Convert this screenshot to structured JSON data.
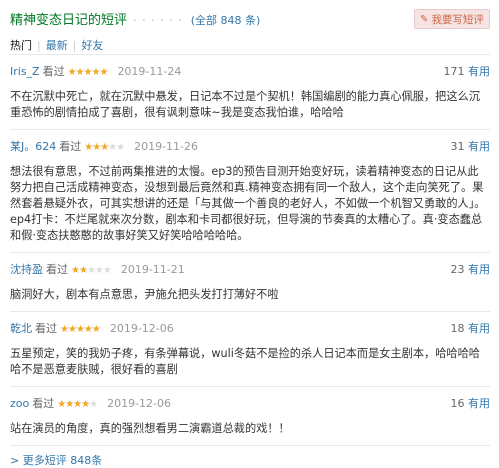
{
  "header": {
    "title": "精神变态日记的短评",
    "dots": "· · · · · ·",
    "all_count": "(全部 848 条)",
    "write_button": "我要写短评",
    "pen_icon": "✎"
  },
  "filters": [
    {
      "label": "热门",
      "active": true
    },
    {
      "label": "最新",
      "active": false
    },
    {
      "label": "好友",
      "active": false
    }
  ],
  "reviews": [
    {
      "user": "Iris_Z",
      "seen": "看过",
      "rating": 5,
      "date": "2019-11-24",
      "votes": "171",
      "useful_label": "有用",
      "text": "不在沉默中死亡，就在沉默中悬发，日记本不过是个契机！韩国编剧的能力真心佩服，把这么沉重恐怖的剧情拍成了喜剧，很有讽刺意味~我是变态我怕谁，哈哈哈"
    },
    {
      "user": "某J。624",
      "seen": "看过",
      "rating": 3,
      "date": "2019-11-26",
      "votes": "31",
      "useful_label": "有用",
      "text": "想法很有意思，不过前两集推进的太慢。ep3的预告目测开始变好玩，读着精神变态的日记从此努力把自己活成精神变态，没想到最后竟然和真.精神变态拥有同一个敌人，这个走向笑死了。果然套着悬疑外衣，可其实想讲的还是「与其做一个善良的老好人，不如做一个机智又勇敢的人」。ep4打卡：不烂尾就来次分数，剧本和卡司都很好玩，但导演的节奏真的太糟心了。真·变态蠢总和假·变态扶憨憨的故事好笑又好笑哈哈哈哈哈。"
    },
    {
      "user": "沈持盈",
      "seen": "看过",
      "rating": 2,
      "date": "2019-11-21",
      "votes": "23",
      "useful_label": "有用",
      "text": "脑洞好大，剧本有点意思，尹施允把头发打打薄好不啦"
    },
    {
      "user": "乾北",
      "seen": "看过",
      "rating": 5,
      "date": "2019-12-06",
      "votes": "18",
      "useful_label": "有用",
      "text": "五星预定，笑的我奶子疼，有条弹幕说，wuli冬菇不是捡的杀人日记本而是女主剧本，哈哈哈哈哈不是恶意麦肤贼，很好看的喜剧"
    },
    {
      "user": "zoo",
      "seen": "看过",
      "rating": 4,
      "date": "2019-12-06",
      "votes": "16",
      "useful_label": "有用",
      "text": "站在演员的角度，真的强烈想看男二演霸道总裁的戏！！"
    }
  ],
  "footer": {
    "more_link": "> 更多短评 848条"
  }
}
